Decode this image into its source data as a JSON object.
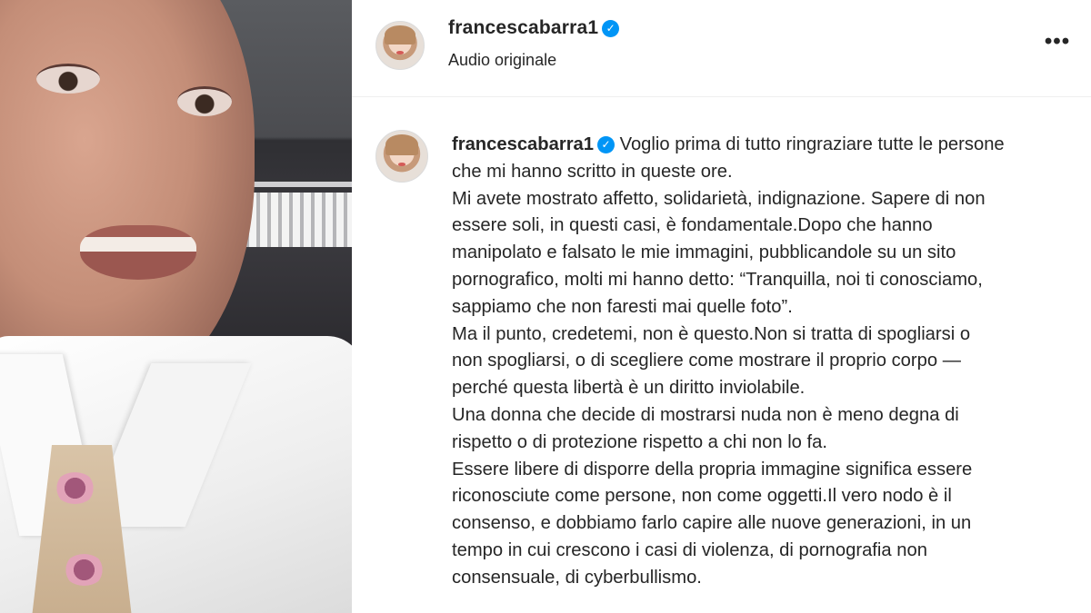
{
  "post": {
    "username": "francescabarra1",
    "audio_label": "Audio originale",
    "more_icon": "more-horizontal-icon",
    "verified_icon": "verified-badge-icon",
    "verified_glyph": "✓",
    "more_glyph": "•••"
  },
  "caption": {
    "username": "francescabarra1",
    "lines": [
      " Voglio prima di tutto ringraziare tutte le persone",
      "che mi hanno scritto in queste ore.",
      "Mi avete mostrato affetto, solidarietà, indignazione. Sapere di non",
      "essere soli, in questi casi, è fondamentale.Dopo che hanno",
      "manipolato e falsato le mie immagini, pubblicandole su un sito",
      "pornografico, molti mi hanno detto: “Tranquilla, noi ti conosciamo,",
      "sappiamo che non faresti mai quelle foto”.",
      "Ma il punto, credetemi, non è questo.Non si tratta di spogliarsi o",
      "non spogliarsi, o di scegliere come mostrare il proprio corpo —",
      "perché questa libertà è un diritto inviolabile.",
      "Una donna che decide di mostrarsi nuda non è meno degna di",
      "rispetto o di protezione rispetto a chi non lo fa.",
      "Essere libere di disporre della propria immagine significa essere",
      "riconosciute come persone, non come oggetti.Il vero nodo è il",
      "consenso, e dobbiamo farlo capire alle nuove generazioni, in un",
      "tempo in cui crescono i casi di violenza, di pornografia non",
      "consensuale, di cyberbullismo."
    ]
  },
  "colors": {
    "text": "#262626",
    "verified": "#0095f6",
    "divider": "#efefef"
  }
}
